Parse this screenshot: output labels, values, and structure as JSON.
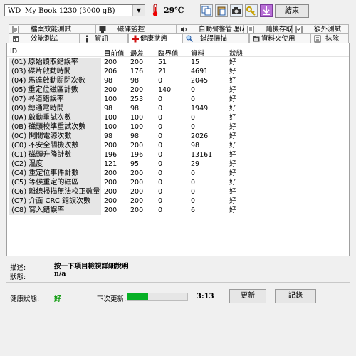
{
  "toolbar": {
    "drive_letter": "WD",
    "drive_model": "My Book 1230 (3000 gB)",
    "temperature": "29℃",
    "exit_label": "結束"
  },
  "tabs_row1": [
    "檔案效能測試",
    "磁碟監控",
    "自動聲響管理(AAM)",
    "隨機存取",
    "額外測試"
  ],
  "tabs_row2": [
    "效能測試",
    "資訊",
    "健康狀態",
    "錯誤掃描",
    "資料夾使用",
    "抹除"
  ],
  "table": {
    "headers": [
      "ID",
      "目前值",
      "最差",
      "臨界值",
      "資料",
      "狀態"
    ],
    "rows": [
      [
        "(01) 原始讀取錯誤率",
        "200",
        "200",
        "51",
        "15",
        "好"
      ],
      [
        "(03) 碟片啟動時間",
        "206",
        "176",
        "21",
        "4691",
        "好"
      ],
      [
        "(04) 馬達啟動關閉次數",
        "98",
        "98",
        "0",
        "2045",
        "好"
      ],
      [
        "(05) 重定位磁區計數",
        "200",
        "200",
        "140",
        "0",
        "好"
      ],
      [
        "(07) 尋道錯誤率",
        "100",
        "253",
        "0",
        "0",
        "好"
      ],
      [
        "(09) 總通電時間",
        "98",
        "98",
        "0",
        "1949",
        "好"
      ],
      [
        "(0A) 啟動重試次數",
        "100",
        "100",
        "0",
        "0",
        "好"
      ],
      [
        "(0B) 磁頭校準重試次數",
        "100",
        "100",
        "0",
        "0",
        "好"
      ],
      [
        "(0C) 開關電源次數",
        "98",
        "98",
        "0",
        "2026",
        "好"
      ],
      [
        "(C0) 不安全關機次數",
        "200",
        "200",
        "0",
        "98",
        "好"
      ],
      [
        "(C1) 磁頭升降計數",
        "196",
        "196",
        "0",
        "13161",
        "好"
      ],
      [
        "(C2) 溫度",
        "121",
        "95",
        "0",
        "29",
        "好"
      ],
      [
        "(C4) 重定位事件計數",
        "200",
        "200",
        "0",
        "0",
        "好"
      ],
      [
        "(C5) 等候重定的磁區",
        "200",
        "200",
        "0",
        "0",
        "好"
      ],
      [
        "(C6) 離線掃描無法校正數量",
        "200",
        "200",
        "0",
        "0",
        "好"
      ],
      [
        "(C7) 介面 CRC 錯誤次數",
        "200",
        "200",
        "0",
        "0",
        "好"
      ],
      [
        "(C8) 寫入錯誤率",
        "200",
        "200",
        "0",
        "6",
        "好"
      ]
    ]
  },
  "description": {
    "label": "描述:",
    "value": "按一下項目檢視詳細說明",
    "status_label": "狀態:",
    "status_value": "n/a"
  },
  "footer": {
    "health_label": "健康狀態:",
    "health_value": "好",
    "next_update_label": "下次更新:",
    "progress_fraction": 0.35,
    "countdown": "3:13",
    "update_label": "更新",
    "log_label": "記錄"
  },
  "colors": {
    "accent_green": "#06b025",
    "good_text": "#0a9a0a"
  }
}
